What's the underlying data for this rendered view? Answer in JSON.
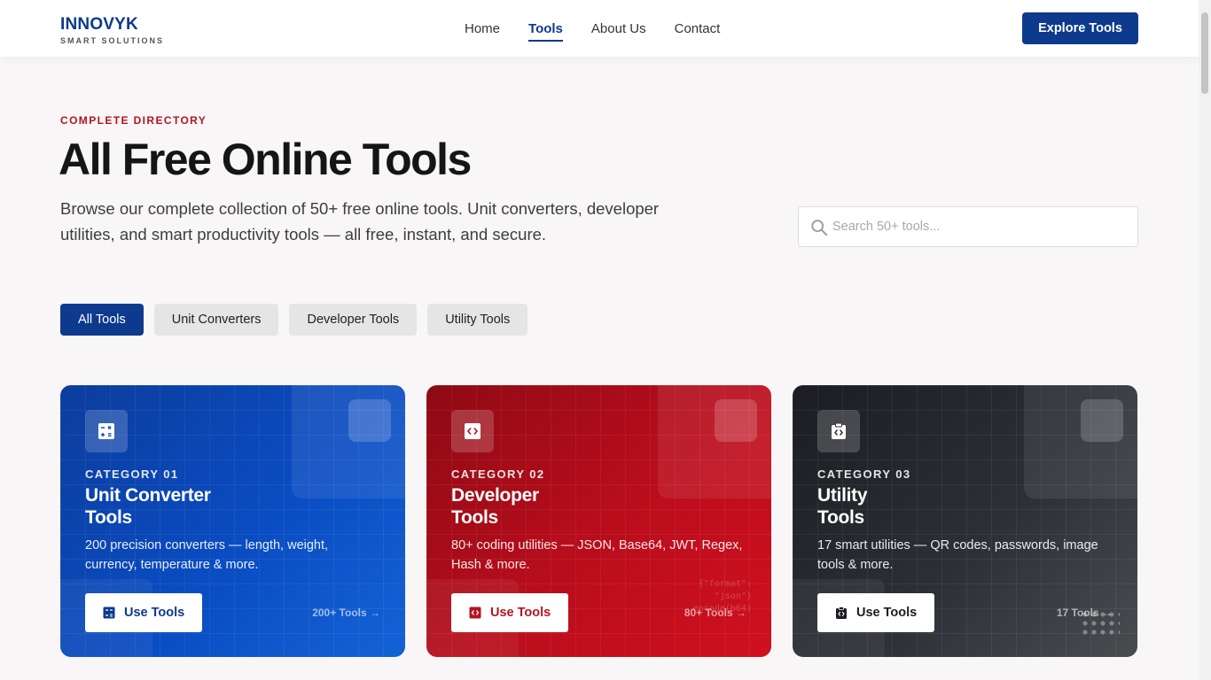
{
  "header": {
    "logo_main": "INNOVYK",
    "logo_sub": "SMART SOLUTIONS",
    "nav": [
      {
        "label": "Home",
        "active": false
      },
      {
        "label": "Tools",
        "active": true
      },
      {
        "label": "About Us",
        "active": false
      },
      {
        "label": "Contact",
        "active": false
      }
    ],
    "cta_label": "Explore Tools"
  },
  "hero": {
    "eyebrow": "COMPLETE DIRECTORY",
    "title": "All Free Online Tools",
    "description": "Browse our complete collection of 50+ free online tools. Unit converters, developer utilities, and smart productivity tools — all free, instant, and secure.",
    "search_placeholder": "Search 50+ tools...",
    "search_icon": "search-icon"
  },
  "filters": [
    {
      "label": "All Tools",
      "active": true
    },
    {
      "label": "Unit Converters",
      "active": false
    },
    {
      "label": "Developer Tools",
      "active": false
    },
    {
      "label": "Utility Tools",
      "active": false
    }
  ],
  "cards": [
    {
      "category": "CATEGORY 01",
      "title_line1": "Unit Converter",
      "title_line2": "Tools",
      "description": "200 precision converters — length, weight, currency, temperature & more.",
      "button_label": "Use Tools",
      "count": "200+ Tools →",
      "icon": "calculator-icon",
      "color": "#0a4cc2"
    },
    {
      "category": "CATEGORY 02",
      "title_line1": "Developer",
      "title_line2": "Tools",
      "description": "80+ coding utilities — JSON, Base64, JWT, Regex, Hash & more.",
      "button_label": "Use Tools",
      "count": "80+ Tools →",
      "code_lines": [
        "{\"format\":",
        "\"json\"}",
        "encode(b64)"
      ],
      "icon": "code-icon",
      "color": "#c30e1e"
    },
    {
      "category": "CATEGORY 03",
      "title_line1": "Utility",
      "title_line2": "Tools",
      "description": "17 smart utilities — QR codes, passwords, image tools & more.",
      "button_label": "Use Tools",
      "count": "17 Tools →",
      "icon": "clipboard-code-icon",
      "color": "#2c2f36"
    }
  ],
  "colors": {
    "brand": "#0d3a8c",
    "accent_red": "#b3151f",
    "background": "#f8f6f7"
  }
}
